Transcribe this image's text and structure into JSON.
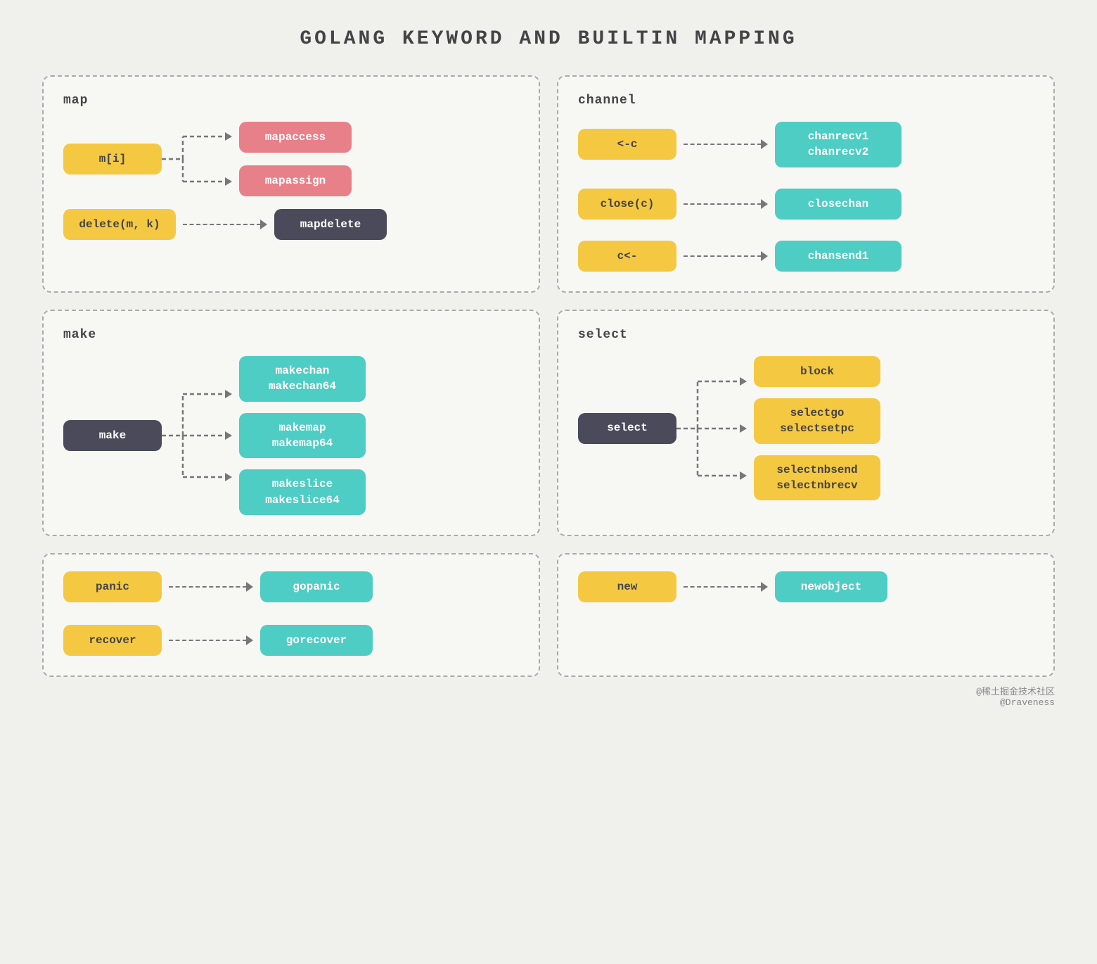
{
  "title": "GOLANG KEYWORD AND BUILTIN MAPPING",
  "watermark": {
    "line1": "@稀土掘金技术社区",
    "line2": "@Draveness"
  },
  "sections": {
    "map": {
      "label": "map",
      "source1": "m[i]",
      "target1a": "mapaccess",
      "target1b": "mapassign",
      "source2": "delete(m, k)",
      "target2": "mapdelete"
    },
    "channel": {
      "label": "channel",
      "rows": [
        {
          "source": "<-c",
          "target": "chanrecv1\nchanrecv2"
        },
        {
          "source": "close(c)",
          "target": "closechan"
        },
        {
          "source": "c<-",
          "target": "chansend1"
        }
      ]
    },
    "make": {
      "label": "make",
      "source": "make",
      "targets": [
        "makechan\nmakechan64",
        "makemap\nmakemap64",
        "makeslice\nmakeslice64"
      ]
    },
    "select": {
      "label": "select",
      "source": "select",
      "targets": [
        "block",
        "selectgo\nselectsetpc",
        "selectnbsend\nselectnbrecv"
      ]
    },
    "panic_recover": {
      "rows": [
        {
          "source": "panic",
          "target": "gopanic"
        },
        {
          "source": "recover",
          "target": "gorecover"
        }
      ]
    },
    "new": {
      "rows": [
        {
          "source": "new",
          "target": "newobject"
        }
      ]
    }
  }
}
